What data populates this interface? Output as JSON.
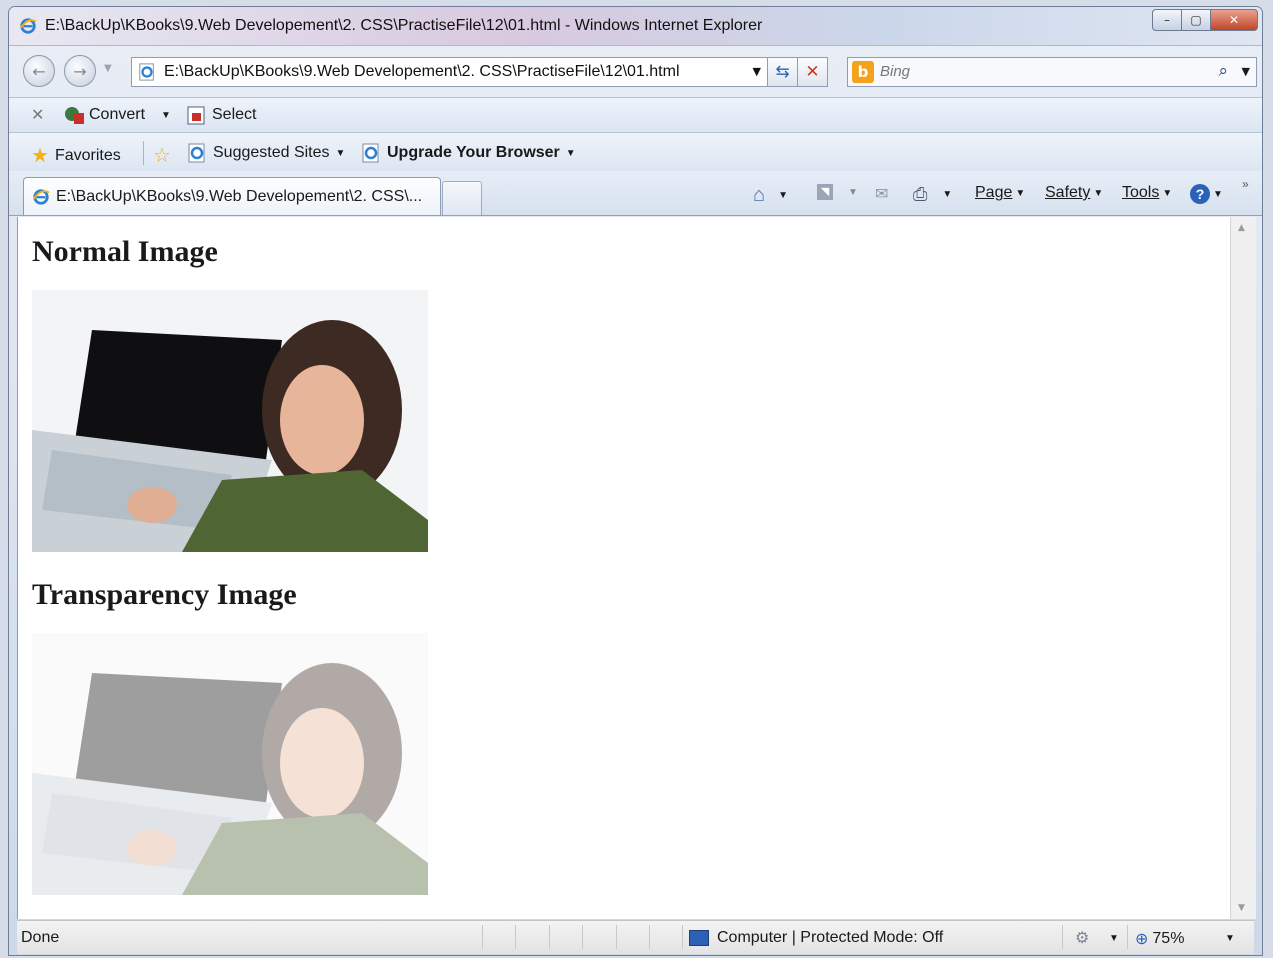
{
  "window": {
    "title": "E:\\BackUp\\KBooks\\9.Web Developement\\2. CSS\\PractiseFile\\12\\01.html - Windows Internet Explorer"
  },
  "address_bar": {
    "url": "E:\\BackUp\\KBooks\\9.Web Developement\\2. CSS\\PractiseFile\\12\\01.html"
  },
  "search": {
    "placeholder": "Bing"
  },
  "command_bar": {
    "convert_label": "Convert",
    "select_label": "Select"
  },
  "favorites_bar": {
    "favorites_label": "Favorites",
    "suggested_sites_label": "Suggested Sites",
    "upgrade_label": "Upgrade Your Browser"
  },
  "tabs": {
    "active_label": "E:\\BackUp\\KBooks\\9.Web Developement\\2. CSS\\..."
  },
  "toolbar": {
    "page_label": "Page",
    "safety_label": "Safety",
    "tools_label": "Tools"
  },
  "content": {
    "heading_normal": "Normal Image",
    "heading_transparent": "Transparency Image"
  },
  "status": {
    "left_text": "Done",
    "zone_text": "Computer | Protected Mode: Off",
    "zoom_text": "75%"
  },
  "colors": {
    "accent": "#2b62b8",
    "close_button": "#c0452b",
    "bing_orange": "#f2a31b"
  }
}
